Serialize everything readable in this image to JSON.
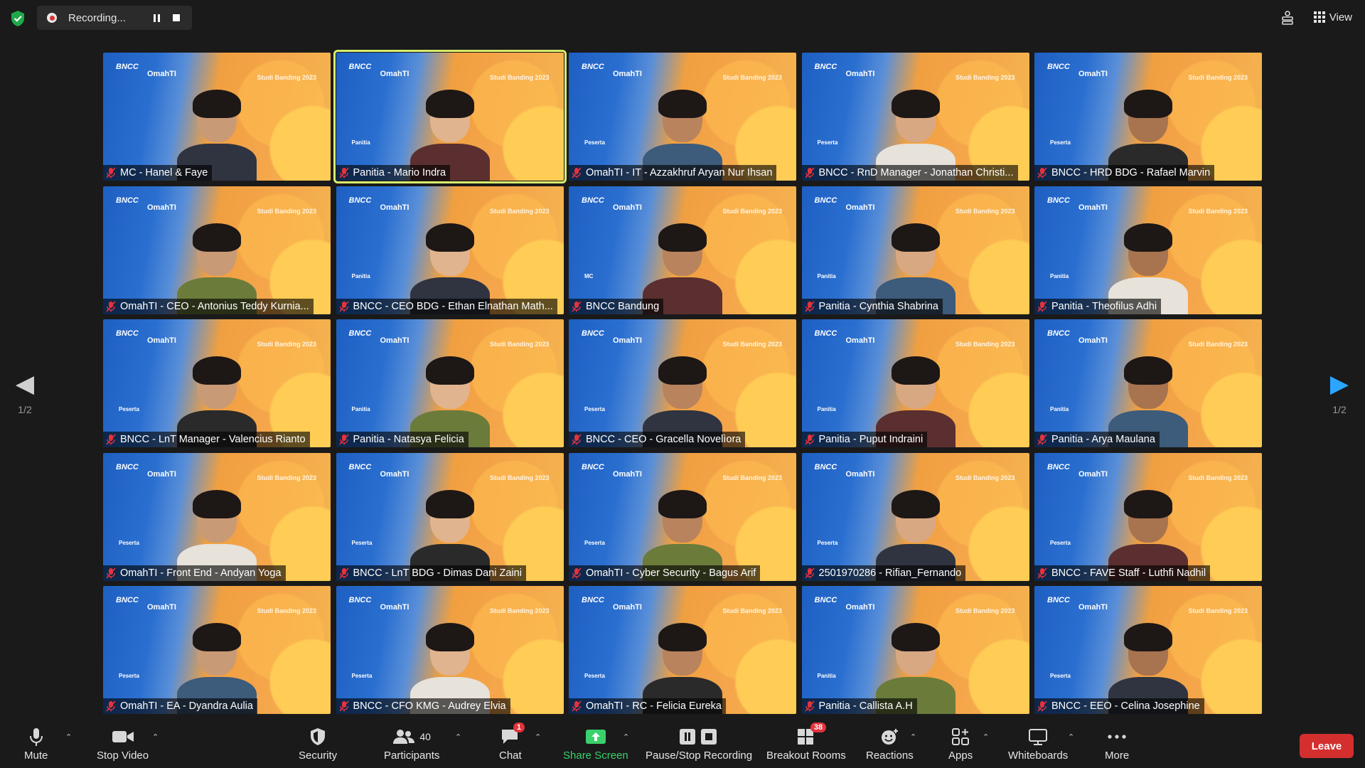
{
  "top_bar": {
    "recording_label": "Recording...",
    "view_label": "View"
  },
  "pager": {
    "left_page": "1/2",
    "right_page": "1/2"
  },
  "tiles": [
    {
      "name": "MC - Hanel & Faye",
      "role": "",
      "active": false
    },
    {
      "name": "Panitia - Mario Indra",
      "role": "Panitia",
      "active": true
    },
    {
      "name": "OmahTI - IT - Azzakhruf Aryan Nur Ihsan",
      "role": "Peserta",
      "active": false
    },
    {
      "name": "BNCC - RnD Manager - Jonathan Christi...",
      "role": "Peserta",
      "active": false
    },
    {
      "name": "BNCC - HRD BDG - Rafael Marvin",
      "role": "Peserta",
      "active": false
    },
    {
      "name": "OmahTI - CEO - Antonius Teddy Kurnia...",
      "role": "",
      "active": false
    },
    {
      "name": "BNCC - CEO BDG - Ethan Elnathan Math...",
      "role": "Panitia",
      "active": false
    },
    {
      "name": "BNCC Bandung",
      "role": "MC",
      "active": false
    },
    {
      "name": "Panitia - Cynthia Shabrina",
      "role": "Panitia",
      "active": false
    },
    {
      "name": "Panitia - Theofilus Adhi",
      "role": "Panitia",
      "active": false
    },
    {
      "name": "BNCC - LnT Manager - Valencius Rianto",
      "role": "Peserta",
      "active": false
    },
    {
      "name": "Panitia - Natasya Felicia",
      "role": "Panitia",
      "active": false
    },
    {
      "name": "BNCC - CEO - Gracella Novelìora",
      "role": "Peserta",
      "active": false
    },
    {
      "name": "Panitia - Puput Indraini",
      "role": "Panitia",
      "active": false
    },
    {
      "name": "Panitia - Arya Maulana",
      "role": "Panitia",
      "active": false
    },
    {
      "name": "OmahTI - Front End - Andyan Yoga",
      "role": "Peserta",
      "active": false
    },
    {
      "name": "BNCC - LnT BDG - Dimas Dani Zaini",
      "role": "Peserta",
      "active": false
    },
    {
      "name": "OmahTI - Cyber Security -  Bagus Arif",
      "role": "Peserta",
      "active": false
    },
    {
      "name": "2501970286 - Rifian_Fernando",
      "role": "Peserta",
      "active": false
    },
    {
      "name": "BNCC - FAVE Staff - Luthfi Nadhil",
      "role": "Peserta",
      "active": false
    },
    {
      "name": "OmahTI - EA - Dyandra Aulia",
      "role": "Peserta",
      "active": false
    },
    {
      "name": "BNCC - CFO KMG - Audrey Elvia",
      "role": "Peserta",
      "active": false
    },
    {
      "name": "OmahTI - RC - Felicia Eureka",
      "role": "Peserta",
      "active": false
    },
    {
      "name": "Panitia - Callista A.H",
      "role": "Panitia",
      "active": false
    },
    {
      "name": "BNCC - EEO - Celina Josephine",
      "role": "Peserta",
      "active": false
    }
  ],
  "toolbar": {
    "mute": "Mute",
    "stop_video": "Stop Video",
    "security": "Security",
    "participants": "Participants",
    "participants_count": "40",
    "chat": "Chat",
    "chat_badge": "1",
    "share_screen": "Share Screen",
    "pause_stop_recording": "Pause/Stop Recording",
    "breakout_rooms": "Breakout Rooms",
    "breakout_badge": "38",
    "reactions": "Reactions",
    "apps": "Apps",
    "whiteboards": "Whiteboards",
    "more": "More",
    "leave": "Leave"
  },
  "colors": {
    "accent_green": "#39d16b",
    "leave_red": "#d32f2f",
    "active_speaker": "#d8ec6a",
    "background": "#1a1a1a"
  }
}
